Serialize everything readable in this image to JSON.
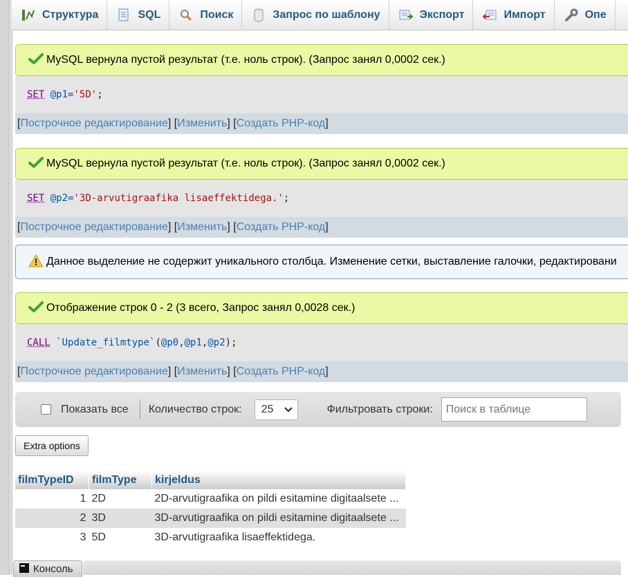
{
  "tabs": [
    {
      "label": "Структура",
      "icon": "structure-icon"
    },
    {
      "label": "SQL",
      "icon": "sql-icon"
    },
    {
      "label": "Поиск",
      "icon": "search-icon"
    },
    {
      "label": "Запрос по шаблону",
      "icon": "query-icon"
    },
    {
      "label": "Экспорт",
      "icon": "export-icon"
    },
    {
      "label": "Импорт",
      "icon": "import-icon"
    },
    {
      "label": "Опе",
      "icon": "wrench-icon"
    }
  ],
  "blocks": [
    {
      "message": "MySQL вернула пустой результат (т.е. ноль строк). (Запрос занял 0,0002 сек.)",
      "sql": {
        "kw": "SET",
        "var": "@p1",
        "eq": "=",
        "str": "'5D'",
        "end": ";"
      }
    },
    {
      "message": "MySQL вернула пустой результат (т.е. ноль строк). (Запрос занял 0,0002 сек.)",
      "sql": {
        "kw": "SET",
        "var": "@p2",
        "eq": "=",
        "str": "'3D-arvutigraafika lisaeffektidega.'",
        "end": ";"
      }
    }
  ],
  "links": {
    "open": "[ ",
    "inline_edit": "Построчное редактирование",
    "sep": " ] [ ",
    "edit": "Изменить",
    "create_php": "Создать PHP-код",
    "close": " ]"
  },
  "warning": "Данное выделение не содержит уникального столбца. Изменение сетки, выставление галочки, редактировани",
  "call_block": {
    "message": "Отображение строк 0 - 2 (3 всего, Запрос занял 0,0028 сек.)",
    "kw": "CALL",
    "proc": "`Update_filmtype`",
    "open": "(",
    "p0": "@p0",
    "c1": ", ",
    "p1": "@p1",
    "c2": ", ",
    "p2": "@p2",
    "close": ");"
  },
  "nav": {
    "show_all": "Показать все",
    "row_count_label": "Количество строк:",
    "row_count_value": "25",
    "filter_label": "Фильтровать строки:",
    "search_placeholder": "Поиск в таблице"
  },
  "extra_options": "Extra options",
  "table": {
    "headers": [
      "filmTypeID",
      "filmType",
      "kirjeldus"
    ],
    "rows": [
      [
        "1",
        "2D",
        "2D-arvutigraafika on pildi esitamine digitaalsete ..."
      ],
      [
        "2",
        "3D",
        "3D-arvutigraafika on pildi esitamine digitaalsete ..."
      ],
      [
        "3",
        "5D",
        "3D-arvutigraafika lisaeffektidega."
      ]
    ]
  },
  "console": "Консоль",
  "colors": {
    "success_bg": "#ebf8a4",
    "link": "#4a80b0",
    "tab_text": "#235a81"
  }
}
